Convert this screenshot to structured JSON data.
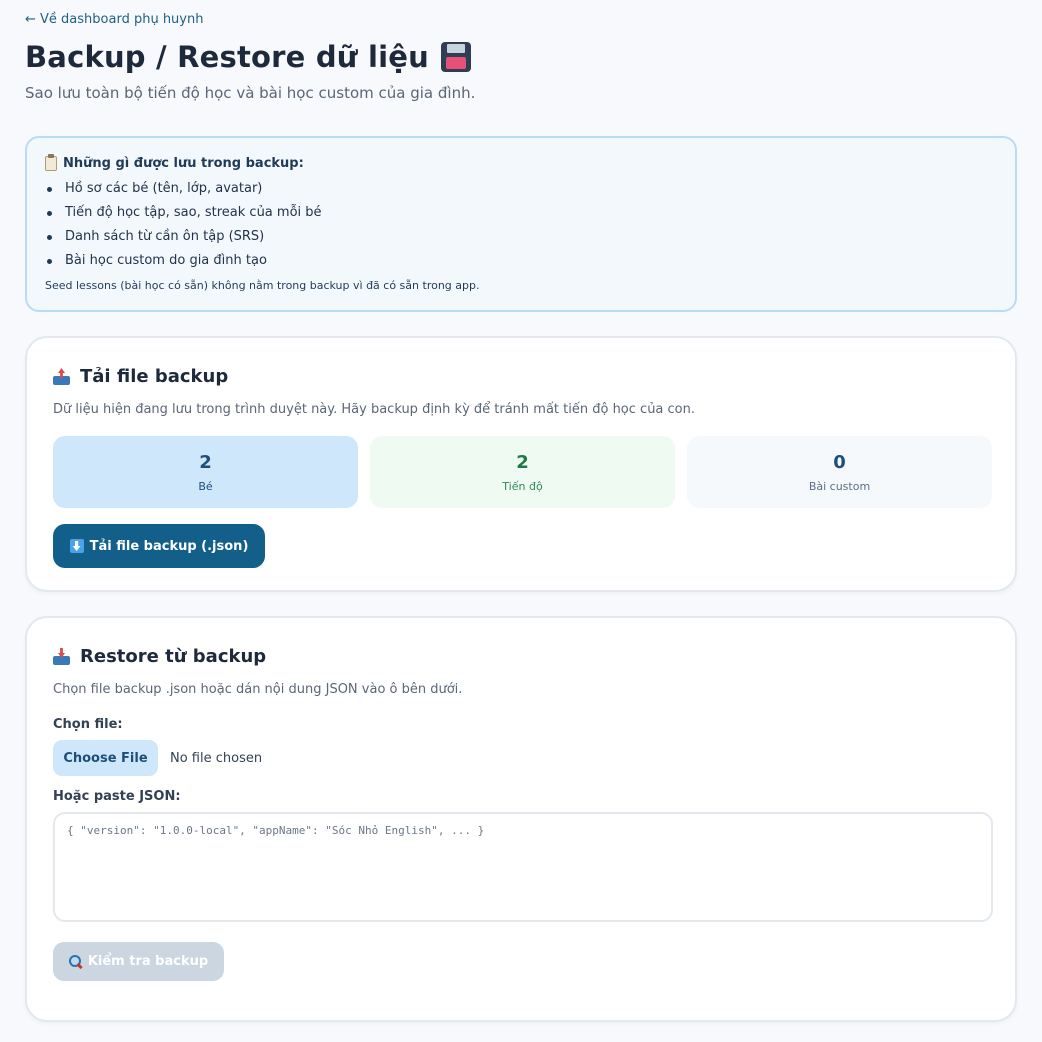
{
  "nav": {
    "back_label": "← Về dashboard phụ huynh"
  },
  "header": {
    "title": "Backup / Restore dữ liệu",
    "title_icon": "floppy-disk-icon",
    "subtitle": "Sao lưu toàn bộ tiến độ học và bài học custom của gia đình."
  },
  "info": {
    "icon": "clipboard-icon",
    "heading": "Những gì được lưu trong backup:",
    "items": [
      "Hồ sơ các bé (tên, lớp, avatar)",
      "Tiến độ học tập, sao, streak của mỗi bé",
      "Danh sách từ cần ôn tập (SRS)",
      "Bài học custom do gia đình tạo"
    ],
    "note": "Seed lessons (bài học có sẵn) không nằm trong backup vì đã có sẵn trong app."
  },
  "download": {
    "icon": "outbox-tray-icon",
    "title": "Tải file backup",
    "description": "Dữ liệu hiện đang lưu trong trình duyệt này. Hãy backup định kỳ để tránh mất tiến độ học của con.",
    "stats": [
      {
        "value": "2",
        "label": "Bé"
      },
      {
        "value": "2",
        "label": "Tiến độ"
      },
      {
        "value": "0",
        "label": "Bài custom"
      }
    ],
    "button_label": "Tải file backup (.json)"
  },
  "restore": {
    "icon": "inbox-tray-icon",
    "title": "Restore từ backup",
    "description": "Chọn file backup .json hoặc dán nội dung JSON vào ô bên dưới.",
    "file_label": "Chọn file:",
    "choose_file_label": "Choose File",
    "file_status": "No file chosen",
    "paste_label": "Hoặc paste JSON:",
    "json_placeholder": "{ \"version\": \"1.0.0-local\", \"appName\": \"Sóc Nhỏ English\", ... }",
    "check_button_label": "Kiểm tra backup"
  },
  "colors": {
    "primary": "#125f8a",
    "info_border": "#b9dcf2",
    "stat_kids_bg": "#cfe7fb",
    "stat_progress_bg": "#effaf2",
    "disabled_button": "#ccd6e1"
  }
}
